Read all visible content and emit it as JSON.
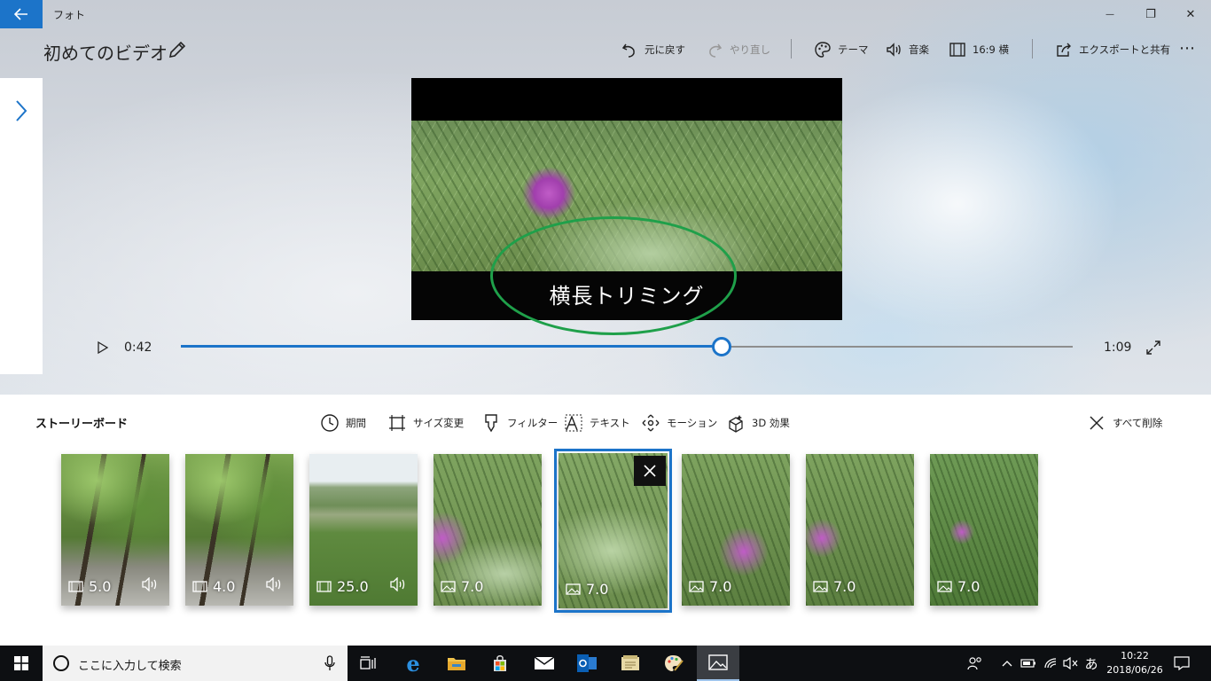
{
  "window": {
    "app_name": "フォト",
    "back_icon": "arrow-left-icon",
    "minimize_glyph": "—",
    "maximize_glyph": "❐",
    "close_glyph": "✕"
  },
  "project": {
    "title": "初めてのビデオ"
  },
  "toolbar": {
    "undo_label": "元に戻す",
    "redo_label": "やり直し",
    "theme_label": "テーマ",
    "music_label": "音楽",
    "aspect_label": "16:9 横",
    "export_label": "エクスポートと共有",
    "more_glyph": "⋯"
  },
  "preview": {
    "caption": "横長トリミング",
    "current_time": "0:42",
    "total_time": "1:09",
    "progress_fraction": 0.606
  },
  "storyboard": {
    "title": "ストーリーボード",
    "tools": {
      "duration": "期間",
      "resize": "サイズ変更",
      "filter": "フィルター",
      "text": "テキスト",
      "motion": "モーション",
      "effects": "3D 効果",
      "delete_all": "すべて削除"
    },
    "clips": [
      {
        "kind": "video",
        "duration": "5.0",
        "audio": true
      },
      {
        "kind": "video",
        "duration": "4.0",
        "audio": true
      },
      {
        "kind": "video",
        "duration": "25.0",
        "audio": true
      },
      {
        "kind": "photo",
        "duration": "7.0",
        "audio": false
      },
      {
        "kind": "photo",
        "duration": "7.0",
        "audio": false,
        "selected": true
      },
      {
        "kind": "photo",
        "duration": "7.0",
        "audio": false
      },
      {
        "kind": "photo",
        "duration": "7.0",
        "audio": false
      },
      {
        "kind": "photo",
        "duration": "7.0",
        "audio": false
      }
    ]
  },
  "taskbar": {
    "search_placeholder": "ここに入力して検索",
    "ime_label": "あ",
    "time": "10:22",
    "date": "2018/06/26"
  },
  "colors": {
    "accent": "#1c74c9",
    "annotation": "#1fa04a",
    "taskbar": "#0d0f12"
  }
}
